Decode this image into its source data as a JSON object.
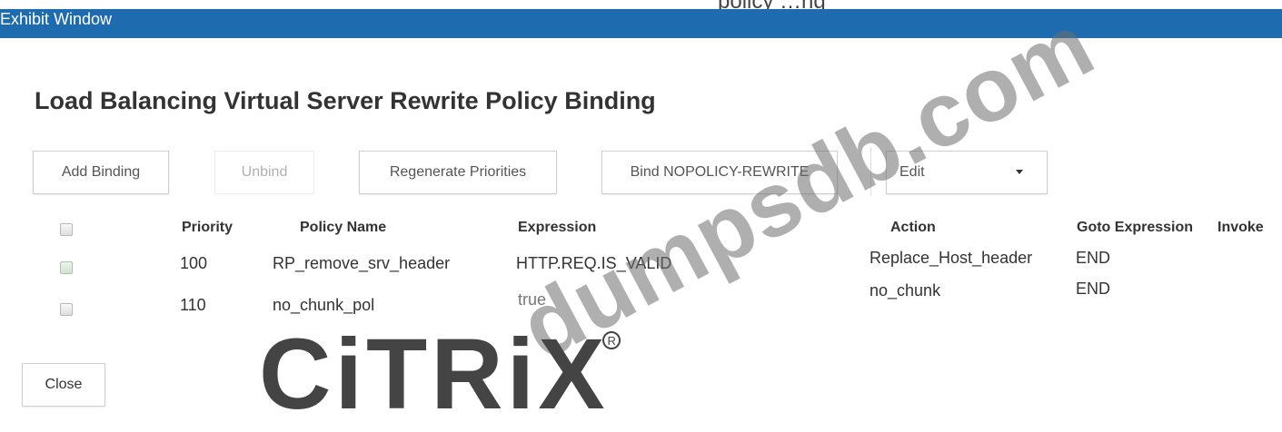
{
  "window": {
    "title": "Exhibit Window",
    "top_fragment": "policy …ng"
  },
  "dialog": {
    "title": "Load Balancing Virtual Server Rewrite Policy Binding"
  },
  "toolbar": {
    "add_binding": "Add Binding",
    "unbind": "Unbind",
    "regenerate_priorities": "Regenerate Priorities",
    "bind_nopolicy": "Bind NOPOLICY-REWRITE",
    "edit": "Edit"
  },
  "table": {
    "columns": [
      "Priority",
      "Policy Name",
      "Expression",
      "Action",
      "Goto Expression",
      "Invoke"
    ],
    "rows": [
      {
        "priority": "100",
        "policy_name": "RP_remove_srv_header",
        "expression": "HTTP.REQ.IS_VALID",
        "action": "Replace_Host_header",
        "goto": "END",
        "invoke": ""
      },
      {
        "priority": "110",
        "policy_name": "no_chunk_pol",
        "expression": "true",
        "action": "no_chunk",
        "goto": "END",
        "invoke": ""
      }
    ]
  },
  "footer": {
    "close": "Close"
  },
  "overlay": {
    "watermark": "dumpsdb.com",
    "logo": "CiTRiX"
  },
  "colors": {
    "titlebar": "#1e6bb0",
    "text": "#333333",
    "watermark": "#6e6e6e"
  }
}
